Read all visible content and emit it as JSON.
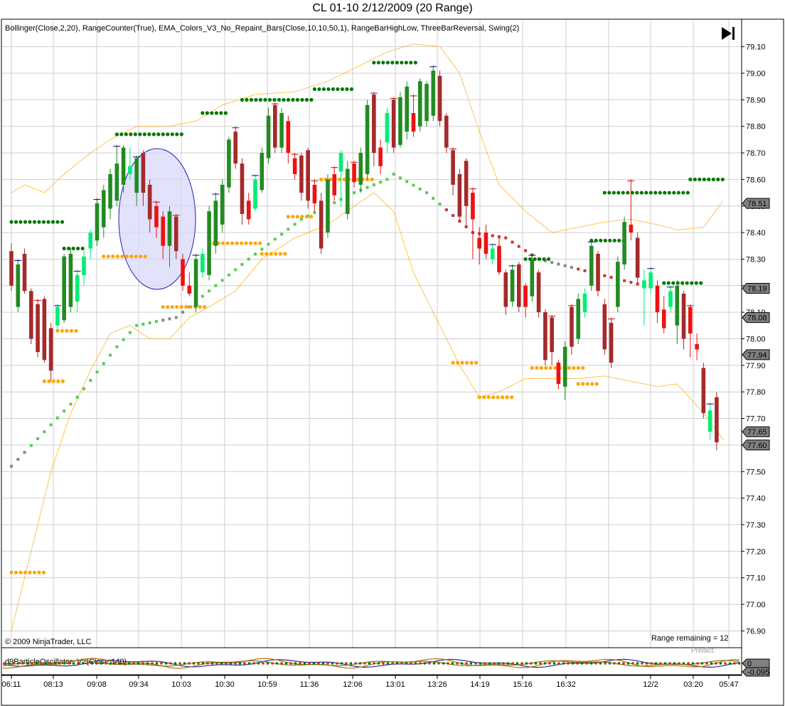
{
  "window_title": "CL 01-10  2/12/2009 (20 Range)",
  "indicators_label": "Bollinger(Close,2,20), RangeCounter(True), EMA_Colors_V3_No_Repaint_Bars(Close,10,10,50,1), RangeBarHighLow, ThreeBarReversal, Swing(2)",
  "copyright": "© 2009 NinjaTrader, LLC",
  "range_remaining": "Range remaining = 12",
  "oscillator_label": "d9ParticleOscillator_V2(Close,140)",
  "oscillator_predict_label": "Predict: ",
  "oscillator_badges": [
    "0",
    "-0.095"
  ],
  "colors": {
    "up_candle": "#00ee76",
    "up_candle_dark": "#228b22",
    "down_candle": "#ee1111",
    "down_candle_dark": "#a52a2a",
    "swing_high": "#007700",
    "swing_low": "#ffa500",
    "bollinger": "#ffa500",
    "ellipse_fill": "#d8d8f8",
    "ellipse_stroke": "#2020c0"
  },
  "play_icon": "skip-end-icon",
  "chart_data": {
    "type": "candlestick",
    "title": "CL 01-10  2/12/2009 (20 Range)",
    "xlabel": "",
    "ylabel": "",
    "ylim": [
      76.85,
      79.17
    ],
    "y_ticks": [
      "79.10",
      "79.00",
      "78.90",
      "78.80",
      "78.70",
      "78.60",
      "78.50",
      "78.40",
      "78.30",
      "78.20",
      "78.10",
      "78.00",
      "77.90",
      "77.80",
      "77.70",
      "77.60",
      "77.50",
      "77.40",
      "77.30",
      "77.20",
      "77.10",
      "77.00",
      "76.90"
    ],
    "x_tick_labels": [
      "06:11",
      "08:13",
      "09:08",
      "09:34",
      "10:03",
      "10:30",
      "10:59",
      "11:36",
      "12:06",
      "13:01",
      "13:26",
      "14:19",
      "15:16",
      "16:32",
      "12/2",
      "03:20",
      "05:47"
    ],
    "price_badges": [
      {
        "label": "78.51",
        "value": 78.51
      },
      {
        "label": "78.19",
        "value": 78.19
      },
      {
        "label": "78.08",
        "value": 78.08
      },
      {
        "label": "77.94",
        "value": 77.94
      },
      {
        "label": "77.65",
        "value": 77.65
      },
      {
        "label": "77.60",
        "value": 77.6
      }
    ],
    "candles": [
      {
        "o": 78.33,
        "c": 78.2,
        "h": 78.36,
        "l": 78.18
      },
      {
        "o": 78.12,
        "c": 78.28,
        "h": 78.3,
        "l": 78.1
      },
      {
        "o": 78.32,
        "c": 78.18,
        "h": 78.34,
        "l": 78.17
      },
      {
        "o": 78.18,
        "c": 78.0,
        "h": 78.19,
        "l": 77.98
      },
      {
        "o": 78.13,
        "c": 77.95,
        "h": 78.15,
        "l": 77.93
      },
      {
        "o": 78.15,
        "c": 77.92,
        "h": 78.16,
        "l": 77.91
      },
      {
        "o": 78.04,
        "c": 77.88,
        "h": 78.06,
        "l": 77.84
      },
      {
        "o": 78.05,
        "c": 78.12,
        "h": 78.13,
        "l": 78.03
      },
      {
        "o": 78.07,
        "c": 78.31,
        "h": 78.32,
        "l": 78.06
      },
      {
        "o": 78.12,
        "c": 78.32,
        "h": 78.34,
        "l": 78.1
      },
      {
        "o": 78.14,
        "c": 78.24,
        "h": 78.26,
        "l": 78.1
      },
      {
        "o": 78.24,
        "c": 78.31,
        "h": 78.33,
        "l": 78.2
      },
      {
        "o": 78.34,
        "c": 78.4,
        "h": 78.41,
        "l": 78.3
      },
      {
        "o": 78.37,
        "c": 78.51,
        "h": 78.53,
        "l": 78.35
      },
      {
        "o": 78.42,
        "c": 78.56,
        "h": 78.58,
        "l": 78.38
      },
      {
        "o": 78.49,
        "c": 78.62,
        "h": 78.64,
        "l": 78.45
      },
      {
        "o": 78.52,
        "c": 78.66,
        "h": 78.73,
        "l": 78.5
      },
      {
        "o": 78.58,
        "c": 78.72,
        "h": 78.73,
        "l": 78.55
      },
      {
        "o": 78.62,
        "c": 78.65,
        "h": 78.72,
        "l": 78.6
      },
      {
        "o": 78.55,
        "c": 78.68,
        "h": 78.69,
        "l": 78.5
      },
      {
        "o": 78.7,
        "c": 78.55,
        "h": 78.71,
        "l": 78.5
      },
      {
        "o": 78.58,
        "c": 78.45,
        "h": 78.6,
        "l": 78.4
      },
      {
        "o": 78.5,
        "c": 78.42,
        "h": 78.52,
        "l": 78.38
      },
      {
        "o": 78.46,
        "c": 78.35,
        "h": 78.48,
        "l": 78.3
      },
      {
        "o": 78.35,
        "c": 78.48,
        "h": 78.5,
        "l": 78.27
      },
      {
        "o": 78.46,
        "c": 78.33,
        "h": 78.47,
        "l": 78.3
      },
      {
        "o": 78.3,
        "c": 78.2,
        "h": 78.32,
        "l": 78.18
      },
      {
        "o": 78.2,
        "c": 78.17,
        "h": 78.25,
        "l": 78.16
      },
      {
        "o": 78.12,
        "c": 78.3,
        "h": 78.32,
        "l": 78.1
      },
      {
        "o": 78.25,
        "c": 78.32,
        "h": 78.34,
        "l": 78.23
      },
      {
        "o": 78.24,
        "c": 78.48,
        "h": 78.5,
        "l": 78.22
      },
      {
        "o": 78.35,
        "c": 78.52,
        "h": 78.55,
        "l": 78.32
      },
      {
        "o": 78.43,
        "c": 78.58,
        "h": 78.6,
        "l": 78.4
      },
      {
        "o": 78.57,
        "c": 78.75,
        "h": 78.76,
        "l": 78.55
      },
      {
        "o": 78.78,
        "c": 78.66,
        "h": 78.8,
        "l": 78.64
      },
      {
        "o": 78.66,
        "c": 78.47,
        "h": 78.68,
        "l": 78.43
      },
      {
        "o": 78.52,
        "c": 78.45,
        "h": 78.55,
        "l": 78.43
      },
      {
        "o": 78.49,
        "c": 78.6,
        "h": 78.62,
        "l": 78.48
      },
      {
        "o": 78.56,
        "c": 78.7,
        "h": 78.72,
        "l": 78.55
      },
      {
        "o": 78.68,
        "c": 78.84,
        "h": 78.87,
        "l": 78.66
      },
      {
        "o": 78.88,
        "c": 78.72,
        "h": 78.89,
        "l": 78.7
      },
      {
        "o": 78.72,
        "c": 78.85,
        "h": 78.87,
        "l": 78.7
      },
      {
        "o": 78.82,
        "c": 78.7,
        "h": 78.84,
        "l": 78.66
      },
      {
        "o": 78.68,
        "c": 78.62,
        "h": 78.7,
        "l": 78.6
      },
      {
        "o": 78.69,
        "c": 78.55,
        "h": 78.7,
        "l": 78.52
      },
      {
        "o": 78.71,
        "c": 78.52,
        "h": 78.72,
        "l": 78.49
      },
      {
        "o": 78.58,
        "c": 78.51,
        "h": 78.6,
        "l": 78.48
      },
      {
        "o": 78.52,
        "c": 78.34,
        "h": 78.55,
        "l": 78.32
      },
      {
        "o": 78.4,
        "c": 78.6,
        "h": 78.62,
        "l": 78.38
      },
      {
        "o": 78.62,
        "c": 78.54,
        "h": 78.65,
        "l": 78.52
      },
      {
        "o": 78.63,
        "c": 78.7,
        "h": 78.71,
        "l": 78.5
      },
      {
        "o": 78.47,
        "c": 78.64,
        "h": 78.67,
        "l": 78.45
      },
      {
        "o": 78.66,
        "c": 78.59,
        "h": 78.67,
        "l": 78.57
      },
      {
        "o": 78.58,
        "c": 78.7,
        "h": 78.72,
        "l": 78.55
      },
      {
        "o": 78.62,
        "c": 78.88,
        "h": 78.9,
        "l": 78.6
      },
      {
        "o": 78.92,
        "c": 78.7,
        "h": 78.93,
        "l": 78.65
      },
      {
        "o": 78.72,
        "c": 78.65,
        "h": 78.75,
        "l": 78.62
      },
      {
        "o": 78.74,
        "c": 78.85,
        "h": 78.87,
        "l": 78.7
      },
      {
        "o": 78.9,
        "c": 78.72,
        "h": 78.91,
        "l": 78.7
      },
      {
        "o": 78.73,
        "c": 78.91,
        "h": 78.93,
        "l": 78.72
      },
      {
        "o": 78.78,
        "c": 78.95,
        "h": 78.97,
        "l": 78.75
      },
      {
        "o": 78.85,
        "c": 78.78,
        "h": 78.92,
        "l": 78.76
      },
      {
        "o": 78.8,
        "c": 78.97,
        "h": 78.98,
        "l": 78.78
      },
      {
        "o": 78.82,
        "c": 78.96,
        "h": 78.97,
        "l": 78.8
      },
      {
        "o": 78.84,
        "c": 79.01,
        "h": 79.03,
        "l": 78.82
      },
      {
        "o": 78.99,
        "c": 78.82,
        "h": 79.01,
        "l": 78.8
      },
      {
        "o": 78.84,
        "c": 78.72,
        "h": 78.85,
        "l": 78.7
      },
      {
        "o": 78.71,
        "c": 78.58,
        "h": 78.72,
        "l": 78.54
      },
      {
        "o": 78.62,
        "c": 78.46,
        "h": 78.64,
        "l": 78.44
      },
      {
        "o": 78.67,
        "c": 78.5,
        "h": 78.68,
        "l": 78.42
      },
      {
        "o": 78.55,
        "c": 78.45,
        "h": 78.57,
        "l": 78.3
      },
      {
        "o": 78.38,
        "c": 78.34,
        "h": 78.42,
        "l": 78.28
      },
      {
        "o": 78.4,
        "c": 78.32,
        "h": 78.43,
        "l": 78.3
      },
      {
        "o": 78.3,
        "c": 78.34,
        "h": 78.36,
        "l": 78.28
      },
      {
        "o": 78.35,
        "c": 78.25,
        "h": 78.38,
        "l": 78.24
      },
      {
        "o": 78.25,
        "c": 78.12,
        "h": 78.26,
        "l": 78.09
      },
      {
        "o": 78.14,
        "c": 78.26,
        "h": 78.28,
        "l": 78.12
      },
      {
        "o": 78.28,
        "c": 78.12,
        "h": 78.29,
        "l": 78.1
      },
      {
        "o": 78.2,
        "c": 78.12,
        "h": 78.21,
        "l": 78.08
      },
      {
        "o": 78.16,
        "c": 78.3,
        "h": 78.32,
        "l": 78.14
      },
      {
        "o": 78.25,
        "c": 78.1,
        "h": 78.26,
        "l": 78.08
      },
      {
        "o": 78.1,
        "c": 77.92,
        "h": 78.11,
        "l": 77.9
      },
      {
        "o": 78.08,
        "c": 77.95,
        "h": 78.09,
        "l": 77.9
      },
      {
        "o": 77.91,
        "c": 77.83,
        "h": 77.92,
        "l": 77.81
      },
      {
        "o": 77.82,
        "c": 77.97,
        "h": 77.99,
        "l": 77.77
      },
      {
        "o": 78.12,
        "c": 77.97,
        "h": 78.13,
        "l": 77.94
      },
      {
        "o": 78.0,
        "c": 78.15,
        "h": 78.17,
        "l": 77.98
      },
      {
        "o": 78.1,
        "c": 78.17,
        "h": 78.19,
        "l": 78.08
      },
      {
        "o": 78.2,
        "c": 78.35,
        "h": 78.37,
        "l": 78.18
      },
      {
        "o": 78.32,
        "c": 78.18,
        "h": 78.33,
        "l": 78.16
      },
      {
        "o": 78.13,
        "c": 77.96,
        "h": 78.15,
        "l": 77.94
      },
      {
        "o": 78.06,
        "c": 77.91,
        "h": 78.08,
        "l": 77.89
      },
      {
        "o": 78.12,
        "c": 78.29,
        "h": 78.31,
        "l": 78.1
      },
      {
        "o": 78.28,
        "c": 78.44,
        "h": 78.46,
        "l": 78.26
      },
      {
        "o": 78.43,
        "c": 78.4,
        "h": 78.6,
        "l": 78.37
      },
      {
        "o": 78.38,
        "c": 78.23,
        "h": 78.4,
        "l": 78.21
      },
      {
        "o": 78.19,
        "c": 78.22,
        "h": 78.26,
        "l": 78.05
      },
      {
        "o": 78.19,
        "c": 78.25,
        "h": 78.27,
        "l": 78.17
      },
      {
        "o": 78.2,
        "c": 78.1,
        "h": 78.22,
        "l": 78.06
      },
      {
        "o": 78.11,
        "c": 78.04,
        "h": 78.16,
        "l": 78.02
      },
      {
        "o": 78.12,
        "c": 78.18,
        "h": 78.2,
        "l": 78.1
      },
      {
        "o": 78.05,
        "c": 78.2,
        "h": 78.22,
        "l": 77.98
      },
      {
        "o": 78.17,
        "c": 78.0,
        "h": 78.18,
        "l": 77.96
      },
      {
        "o": 78.12,
        "c": 78.02,
        "h": 78.13,
        "l": 77.93
      },
      {
        "o": 77.98,
        "c": 77.96,
        "h": 78.02,
        "l": 77.92
      },
      {
        "o": 77.89,
        "c": 77.72,
        "h": 77.91,
        "l": 77.7
      },
      {
        "o": 77.65,
        "c": 77.73,
        "h": 77.76,
        "l": 77.62
      },
      {
        "o": 77.78,
        "c": 77.61,
        "h": 77.8,
        "l": 77.58
      }
    ],
    "swing_highs": [
      {
        "i0": 0,
        "i1": 8,
        "y": 78.44
      },
      {
        "i0": 8,
        "i1": 11,
        "y": 78.34
      },
      {
        "i0": 16,
        "i1": 26,
        "y": 78.77
      },
      {
        "i0": 29,
        "i1": 33,
        "y": 78.85
      },
      {
        "i0": 35,
        "i1": 46,
        "y": 78.9
      },
      {
        "i0": 46,
        "i1": 52,
        "y": 78.94
      },
      {
        "i0": 55,
        "i1": 62,
        "y": 79.04
      },
      {
        "i0": 78,
        "i1": 82,
        "y": 78.3
      },
      {
        "i0": 88,
        "i1": 93,
        "y": 78.37
      },
      {
        "i0": 90,
        "i1": 103,
        "y": 78.55
      },
      {
        "i0": 103,
        "i1": 108,
        "y": 78.6
      },
      {
        "i0": 99,
        "i1": 105,
        "y": 78.21
      }
    ],
    "swing_lows": [
      {
        "i0": 0,
        "i1": 5,
        "y": 77.12
      },
      {
        "i0": 7,
        "i1": 10,
        "y": 78.03
      },
      {
        "i0": 5,
        "i1": 8,
        "y": 77.84
      },
      {
        "i0": 14,
        "i1": 21,
        "y": 78.31
      },
      {
        "i0": 23,
        "i1": 30,
        "y": 78.12
      },
      {
        "i0": 30,
        "i1": 38,
        "y": 78.36
      },
      {
        "i0": 38,
        "i1": 42,
        "y": 78.32
      },
      {
        "i0": 42,
        "i1": 46,
        "y": 78.46
      },
      {
        "i0": 47,
        "i1": 55,
        "y": 78.6
      },
      {
        "i0": 67,
        "i1": 71,
        "y": 77.91
      },
      {
        "i0": 71,
        "i1": 76,
        "y": 77.78
      },
      {
        "i0": 79,
        "i1": 87,
        "y": 77.89
      },
      {
        "i0": 86,
        "i1": 89,
        "y": 77.83
      }
    ],
    "ema_trend": [
      {
        "x": 0,
        "y": 77.52
      },
      {
        "x": 10,
        "y": 77.78
      },
      {
        "x": 16,
        "y": 77.97
      },
      {
        "x": 19,
        "y": 78.05
      },
      {
        "x": 25,
        "y": 78.08
      },
      {
        "x": 30,
        "y": 78.18
      },
      {
        "x": 36,
        "y": 78.3
      },
      {
        "x": 44,
        "y": 78.45
      },
      {
        "x": 52,
        "y": 78.55
      },
      {
        "x": 57,
        "y": 78.6
      },
      {
        "x": 58,
        "y": 78.62
      },
      {
        "x": 63,
        "y": 78.55
      },
      {
        "x": 70,
        "y": 78.4
      },
      {
        "x": 75,
        "y": 78.38
      },
      {
        "x": 80,
        "y": 78.3
      },
      {
        "x": 88,
        "y": 78.25
      },
      {
        "x": 96,
        "y": 78.2
      }
    ],
    "bollinger_upper": [
      {
        "x": 0,
        "y": 78.55
      },
      {
        "x": 2,
        "y": 78.58
      },
      {
        "x": 5,
        "y": 78.55
      },
      {
        "x": 8,
        "y": 78.62
      },
      {
        "x": 12,
        "y": 78.7
      },
      {
        "x": 15,
        "y": 78.75
      },
      {
        "x": 19,
        "y": 78.8
      },
      {
        "x": 24,
        "y": 78.8
      },
      {
        "x": 28,
        "y": 78.82
      },
      {
        "x": 32,
        "y": 78.88
      },
      {
        "x": 37,
        "y": 78.92
      },
      {
        "x": 43,
        "y": 78.93
      },
      {
        "x": 48,
        "y": 78.97
      },
      {
        "x": 53,
        "y": 79.03
      },
      {
        "x": 57,
        "y": 79.08
      },
      {
        "x": 61,
        "y": 79.11
      },
      {
        "x": 65,
        "y": 79.1
      },
      {
        "x": 68,
        "y": 79.0
      },
      {
        "x": 71,
        "y": 78.78
      },
      {
        "x": 74,
        "y": 78.58
      },
      {
        "x": 78,
        "y": 78.48
      },
      {
        "x": 82,
        "y": 78.4
      },
      {
        "x": 86,
        "y": 78.42
      },
      {
        "x": 90,
        "y": 78.44
      },
      {
        "x": 94,
        "y": 78.45
      },
      {
        "x": 98,
        "y": 78.43
      },
      {
        "x": 101,
        "y": 78.41
      },
      {
        "x": 105,
        "y": 78.42
      },
      {
        "x": 108,
        "y": 78.52
      }
    ],
    "bollinger_lower": [
      {
        "x": 0,
        "y": 76.9
      },
      {
        "x": 3,
        "y": 77.2
      },
      {
        "x": 6,
        "y": 77.5
      },
      {
        "x": 9,
        "y": 77.72
      },
      {
        "x": 12,
        "y": 77.88
      },
      {
        "x": 15,
        "y": 78.02
      },
      {
        "x": 18,
        "y": 78.05
      },
      {
        "x": 21,
        "y": 78.0
      },
      {
        "x": 24,
        "y": 78.0
      },
      {
        "x": 27,
        "y": 78.08
      },
      {
        "x": 30,
        "y": 78.12
      },
      {
        "x": 34,
        "y": 78.18
      },
      {
        "x": 38,
        "y": 78.3
      },
      {
        "x": 43,
        "y": 78.38
      },
      {
        "x": 48,
        "y": 78.43
      },
      {
        "x": 52,
        "y": 78.5
      },
      {
        "x": 55,
        "y": 78.55
      },
      {
        "x": 58,
        "y": 78.48
      },
      {
        "x": 61,
        "y": 78.25
      },
      {
        "x": 65,
        "y": 78.05
      },
      {
        "x": 68,
        "y": 77.9
      },
      {
        "x": 71,
        "y": 77.78
      },
      {
        "x": 74,
        "y": 77.8
      },
      {
        "x": 78,
        "y": 77.85
      },
      {
        "x": 82,
        "y": 77.85
      },
      {
        "x": 86,
        "y": 77.85
      },
      {
        "x": 90,
        "y": 77.86
      },
      {
        "x": 94,
        "y": 77.84
      },
      {
        "x": 98,
        "y": 77.82
      },
      {
        "x": 101,
        "y": 77.83
      },
      {
        "x": 105,
        "y": 77.72
      },
      {
        "x": 108,
        "y": 77.62
      }
    ]
  }
}
